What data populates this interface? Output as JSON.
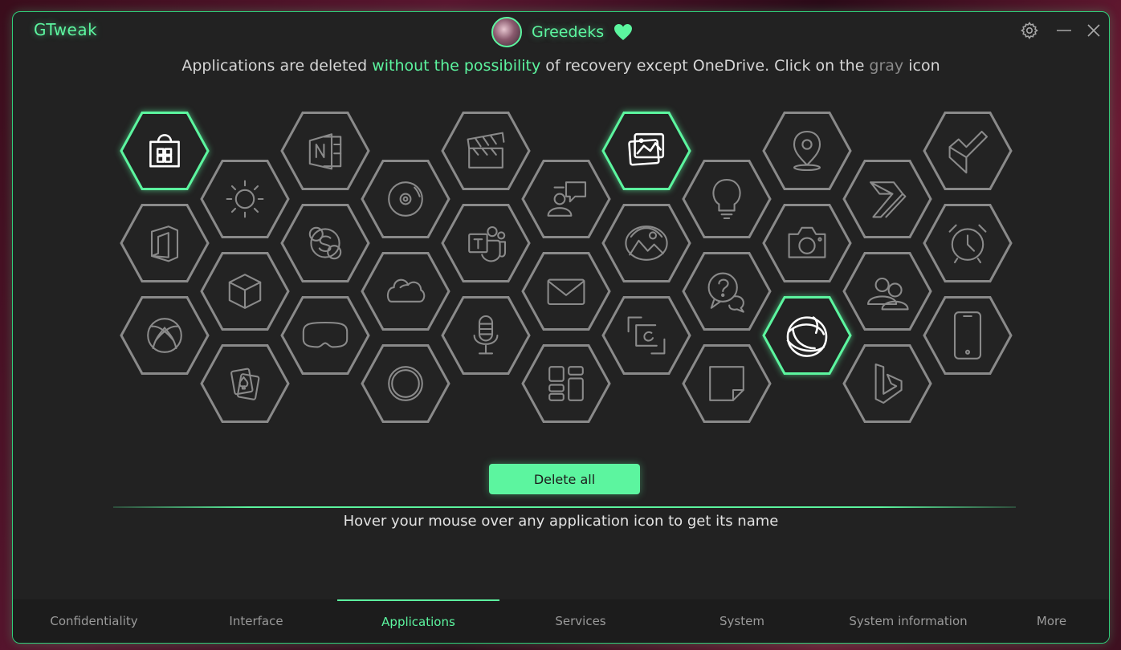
{
  "app": {
    "title": "GTweak"
  },
  "user": {
    "name": "Greedeks"
  },
  "notice": {
    "part1": "Applications are deleted ",
    "highlight": "without the possibility",
    "part2": " of recovery except OneDrive. Click on the ",
    "gray_word": "gray",
    "part3": " icon"
  },
  "apps": [
    {
      "icon": "microsoft-store-icon",
      "state": "active"
    },
    {
      "icon": "office-icon",
      "state": "gray"
    },
    {
      "icon": "xbox-icon",
      "state": "gray"
    },
    {
      "icon": "weather-sun-icon",
      "state": "gray"
    },
    {
      "icon": "3d-cube-icon",
      "state": "gray"
    },
    {
      "icon": "solitaire-cards-icon",
      "state": "gray"
    },
    {
      "icon": "onenote-icon",
      "state": "gray"
    },
    {
      "icon": "skype-icon",
      "state": "gray"
    },
    {
      "icon": "mixed-reality-headset-icon",
      "state": "gray"
    },
    {
      "icon": "groove-music-disc-icon",
      "state": "gray"
    },
    {
      "icon": "onedrive-cloud-icon",
      "state": "gray"
    },
    {
      "icon": "cortana-circle-icon",
      "state": "gray"
    },
    {
      "icon": "video-clapperboard-icon",
      "state": "gray"
    },
    {
      "icon": "teams-icon",
      "state": "gray"
    },
    {
      "icon": "voice-recorder-mic-icon",
      "state": "gray"
    },
    {
      "icon": "feedback-hub-icon",
      "state": "gray"
    },
    {
      "icon": "mail-envelope-icon",
      "state": "gray"
    },
    {
      "icon": "widgets-icon",
      "state": "gray"
    },
    {
      "icon": "photos-icon",
      "state": "active"
    },
    {
      "icon": "paint-3d-icon",
      "state": "gray"
    },
    {
      "icon": "snip-sketch-icon",
      "state": "gray"
    },
    {
      "icon": "tips-bulb-icon",
      "state": "gray"
    },
    {
      "icon": "get-help-icon",
      "state": "gray"
    },
    {
      "icon": "sticky-notes-icon",
      "state": "gray"
    },
    {
      "icon": "maps-pin-icon",
      "state": "gray"
    },
    {
      "icon": "camera-icon",
      "state": "gray"
    },
    {
      "icon": "edge-browser-icon",
      "state": "active"
    },
    {
      "icon": "power-automate-icon",
      "state": "gray"
    },
    {
      "icon": "people-icon",
      "state": "gray"
    },
    {
      "icon": "bing-icon",
      "state": "gray"
    },
    {
      "icon": "todo-check-icon",
      "state": "gray"
    },
    {
      "icon": "alarms-clock-icon",
      "state": "gray"
    },
    {
      "icon": "phone-link-icon",
      "state": "gray"
    }
  ],
  "actions": {
    "delete_all": "Delete all"
  },
  "hint": "Hover your mouse over any application icon to get its name",
  "nav": [
    {
      "label": "Confidentiality",
      "active": false
    },
    {
      "label": "Interface",
      "active": false
    },
    {
      "label": "Applications",
      "active": true
    },
    {
      "label": "Services",
      "active": false
    },
    {
      "label": "System",
      "active": false
    },
    {
      "label": "System information",
      "active": false
    },
    {
      "label": "More",
      "active": false
    }
  ],
  "colors": {
    "accent": "#5cf59f",
    "gray_icon": "#8a8a8a",
    "active_icon": "#ffffff",
    "window_bg": "#222222"
  }
}
